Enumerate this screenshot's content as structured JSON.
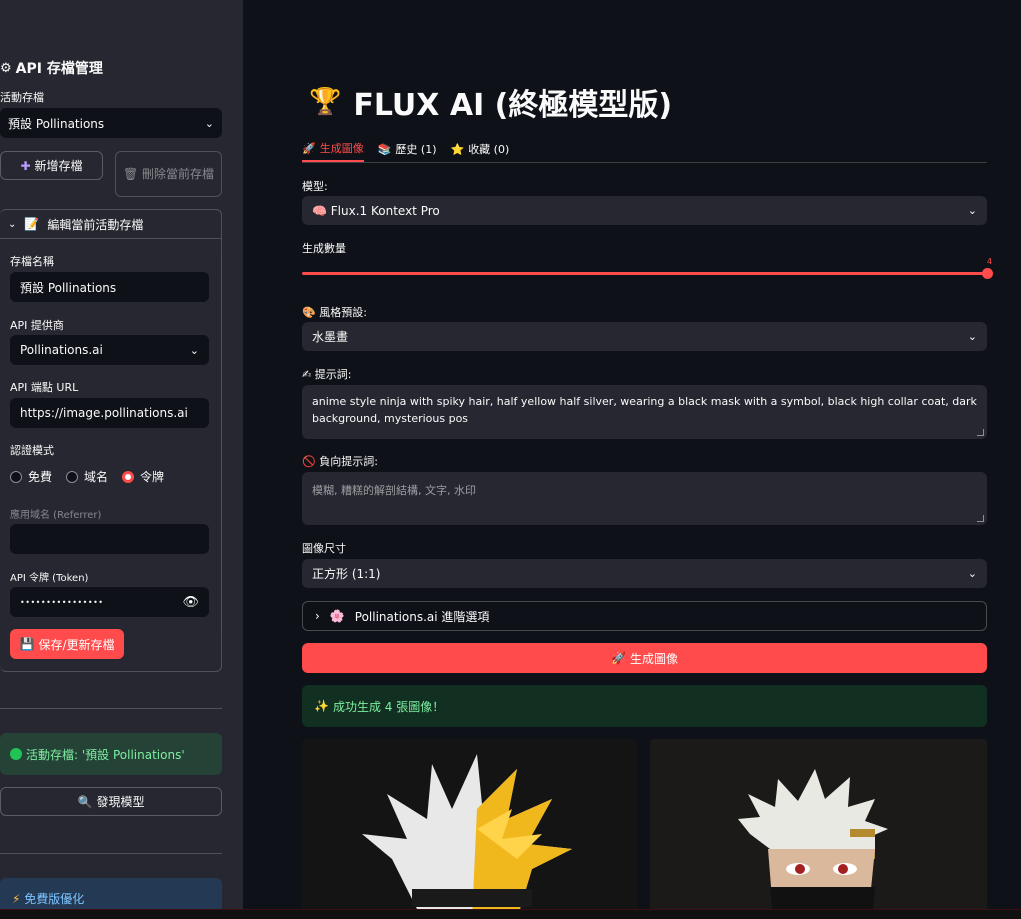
{
  "sidebar": {
    "title_icon": "gear-icon",
    "title": "API 存檔管理",
    "active_profile_label": "活動存檔",
    "active_profile_value": "預設 Pollinations",
    "add_button": "新增存檔",
    "delete_button": "刪除當前存檔",
    "edit_expander": "編輯當前活動存檔",
    "name_label": "存檔名稱",
    "name_value": "預設 Pollinations",
    "provider_label": "API 提供商",
    "provider_value": "Pollinations.ai",
    "endpoint_label": "API 端點 URL",
    "endpoint_value": "https://image.pollinations.ai",
    "auth_label": "認證模式",
    "auth_options": [
      "免費",
      "域名",
      "令牌"
    ],
    "auth_selected": "令牌",
    "referrer_label": "應用域名 (Referrer)",
    "referrer_value": "",
    "token_label": "API 令牌 (Token)",
    "token_value": "••••••••••••••••",
    "save_button": "保存/更新存檔",
    "active_status": "活動存檔: '預設 Pollinations'",
    "discover_button": "發現模型",
    "free_opt": "免費版優化"
  },
  "main": {
    "title_icon": "trophy-icon",
    "title": "FLUX AI (終極模型版)",
    "tabs": [
      {
        "icon": "rocket-icon",
        "label": "生成圖像"
      },
      {
        "icon": "books-icon",
        "label": "歷史 (1)"
      },
      {
        "icon": "star-icon",
        "label": "收藏 (0)"
      }
    ],
    "model_label": "模型:",
    "model_value": "Flux.1 Kontext Pro",
    "count_label": "生成數量",
    "count_value": "4",
    "style_label": "風格預設:",
    "style_value": "水墨畫",
    "prompt_label": "提示詞:",
    "prompt_value": "anime style ninja with spiky hair, half yellow half silver, wearing a black mask with a symbol, black high collar coat, dark background, mysterious pos",
    "negative_label": "負向提示詞:",
    "negative_placeholder": "模糊, 糟糕的解剖結構, 文字, 水印",
    "size_label": "圖像尺寸",
    "size_value": "正方形 (1:1)",
    "advanced_expander": "Pollinations.ai 進階選項",
    "generate_button": "生成圖像",
    "success_message": "成功生成 4 張圖像！"
  },
  "colors": {
    "accent": "#ff4b4b",
    "sidebar_bg": "#262730",
    "main_bg": "#0e1117",
    "success": "#21c354"
  }
}
